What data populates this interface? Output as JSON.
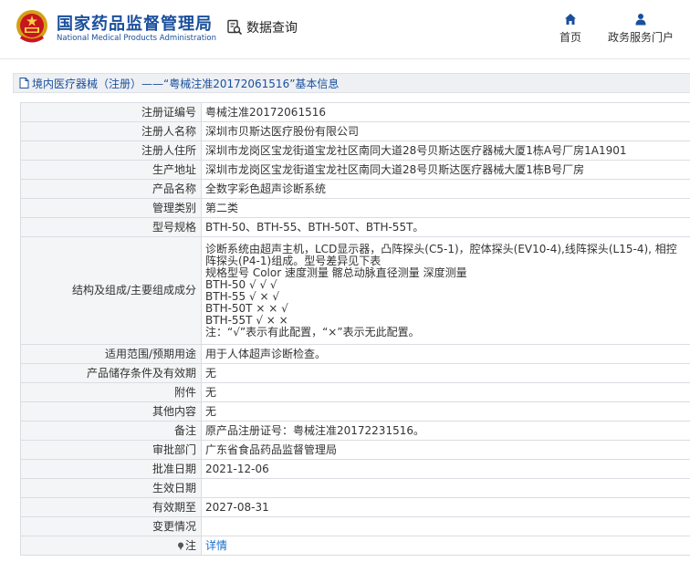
{
  "header": {
    "org_name_cn": "国家药品监督管理局",
    "org_name_en": "National Medical Products Administration",
    "query_label": "数据查询",
    "nav": [
      {
        "label": "首页",
        "icon": "home-icon"
      },
      {
        "label": "政务服务门户",
        "icon": "user-icon"
      }
    ]
  },
  "breadcrumb": {
    "text": "境内医疗器械（注册）——“粤械注准20172061516”基本信息"
  },
  "details": [
    {
      "label": "注册证编号",
      "value": "粤械注准20172061516"
    },
    {
      "label": "注册人名称",
      "value": "深圳市贝斯达医疗股份有限公司"
    },
    {
      "label": "注册人住所",
      "value": "深圳市龙岗区宝龙街道宝龙社区南同大道28号贝斯达医疗器械大厦1栋A号厂房1A1901"
    },
    {
      "label": "生产地址",
      "value": "深圳市龙岗区宝龙街道宝龙社区南同大道28号贝斯达医疗器械大厦1栋B号厂房"
    },
    {
      "label": "产品名称",
      "value": "全数字彩色超声诊断系统"
    },
    {
      "label": "管理类别",
      "value": "第二类"
    },
    {
      "label": "型号规格",
      "value": "BTH-50、BTH-55、BTH-50T、BTH-55T。"
    },
    {
      "label": "结构及组成/主要组成成分",
      "value": "诊断系统由超声主机，LCD显示器，凸阵探头(C5-1)，腔体探头(EV10-4),线阵探头(L15-4), 相控阵探头(P4-1)组成。型号差异见下表\n规格型号 Color 速度测量 髂总动脉直径测量 深度测量\nBTH-50 √ √ √\nBTH-55 √ × √\nBTH-50T × × √\nBTH-55T √ × ×\n注：“√”表示有此配置，“×”表示无此配置。"
    },
    {
      "label": "适用范围/预期用途",
      "value": "用于人体超声诊断检查。"
    },
    {
      "label": "产品储存条件及有效期",
      "value": "无"
    },
    {
      "label": "附件",
      "value": "无"
    },
    {
      "label": "其他内容",
      "value": "无"
    },
    {
      "label": "备注",
      "value": "原产品注册证号：粤械注准20172231516。"
    },
    {
      "label": "审批部门",
      "value": "广东省食品药品监督管理局"
    },
    {
      "label": "批准日期",
      "value": "2021-12-06"
    },
    {
      "label": "生效日期",
      "value": ""
    },
    {
      "label": "有效期至",
      "value": "2027-08-31"
    },
    {
      "label": "变更情况",
      "value": ""
    },
    {
      "label": "注",
      "value": "详情"
    }
  ]
}
